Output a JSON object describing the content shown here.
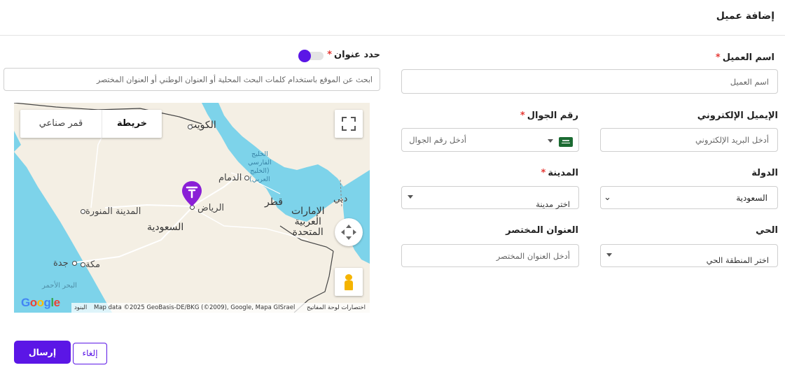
{
  "header": {
    "title": "إضافة عميل"
  },
  "form": {
    "customer_name": {
      "label": "اسم العميل",
      "placeholder": "اسم العميل"
    },
    "email": {
      "label": "الإيميل الإلكتروني",
      "placeholder": "أدخل البريد الإلكتروني"
    },
    "mobile": {
      "label": "رقم الجوال",
      "placeholder": "أدخل رقم الجوال",
      "country_flag": "saudi-arabia-flag-icon"
    },
    "country": {
      "label": "الدولة",
      "value": "السعودية"
    },
    "city": {
      "label": "المدينة",
      "placeholder": "اختر مدينة"
    },
    "district": {
      "label": "الحي",
      "placeholder": "اختر المنطقة الحي"
    },
    "short_address": {
      "label": "العنوان المختصر",
      "placeholder": "أدخل العنوان المختصر"
    },
    "required_mark": "*"
  },
  "address": {
    "label": "حدد عنوان",
    "toggle_on": true,
    "search_placeholder": "ابحث عن الموقع  باستخدام كلمات البحث المحلية أو العنوان الوطني أو العنوان المختصر"
  },
  "map": {
    "tabs": {
      "map": "خريطة",
      "satellite": "قمر صناعي"
    },
    "labels": {
      "kuwait": "الكويت",
      "dammam": "الدمام",
      "gulf": "الخليج\nالفارسي\n(الخليج\nالعربي)",
      "qatar": "قطر",
      "dubai": "دبي",
      "uae": "الإمارات\nالعربية\nالمتحدة",
      "riyadh": "الرياض",
      "madinah": "المدينة المنورة",
      "saudi": "السعودية",
      "jeddah": "جدة",
      "makkah": "مكة",
      "red_sea": "البحر الأحمر"
    },
    "attribution": {
      "terms": "البنود",
      "data": "Map data ©2025 GeoBasis-DE/BKG (©2009), Google, Mapa GISrael",
      "shortcuts": "اختصارات لوحة المفاتيح"
    },
    "logo_text": "Google",
    "accent_color": "#5b16e6"
  },
  "actions": {
    "submit": "إرسال",
    "cancel": "إلغاء"
  }
}
